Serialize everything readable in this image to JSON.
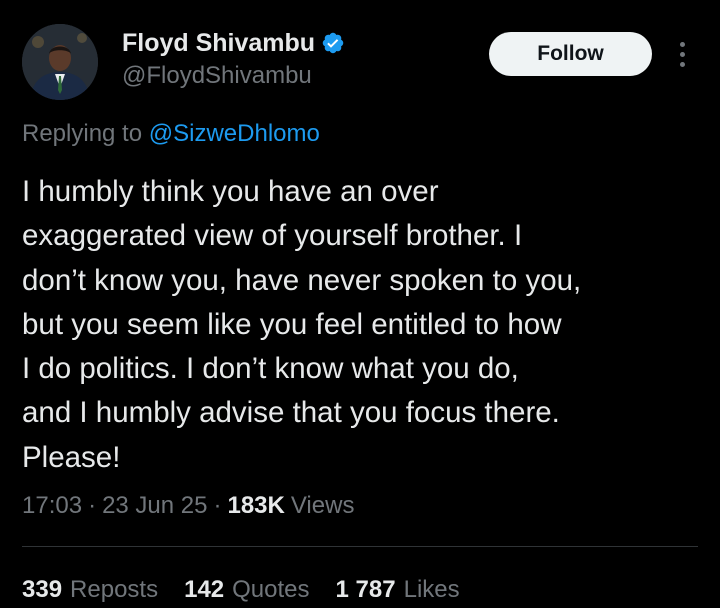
{
  "author": {
    "display_name": "Floyd Shivambu",
    "handle": "@FloydShivambu",
    "verified": true
  },
  "follow_label": "Follow",
  "reply": {
    "prefix": "Replying to",
    "to_handle": "@SizweDhlomo"
  },
  "text_lines": [
    "I humbly think you have an over",
    "exaggerated view of yourself brother. I",
    "don’t know you, have never spoken to you,",
    "but you seem like you feel entitled to how",
    "I do politics. I don’t know what you do,",
    "and I humbly advise that you focus there.",
    "Please!"
  ],
  "meta": {
    "time": "17:03",
    "date": "23 Jun 25",
    "separator": "·",
    "views_count": "183K",
    "views_label": "Views"
  },
  "stats": {
    "reposts_count": "339",
    "reposts_label": "Reposts",
    "quotes_count": "142",
    "quotes_label": "Quotes",
    "likes_count": "1 787",
    "likes_label": "Likes"
  },
  "colors": {
    "background": "#000000",
    "text": "#e7e9ea",
    "secondary": "#71767b",
    "link": "#1d9bf0",
    "verified": "#1d9bf0"
  }
}
